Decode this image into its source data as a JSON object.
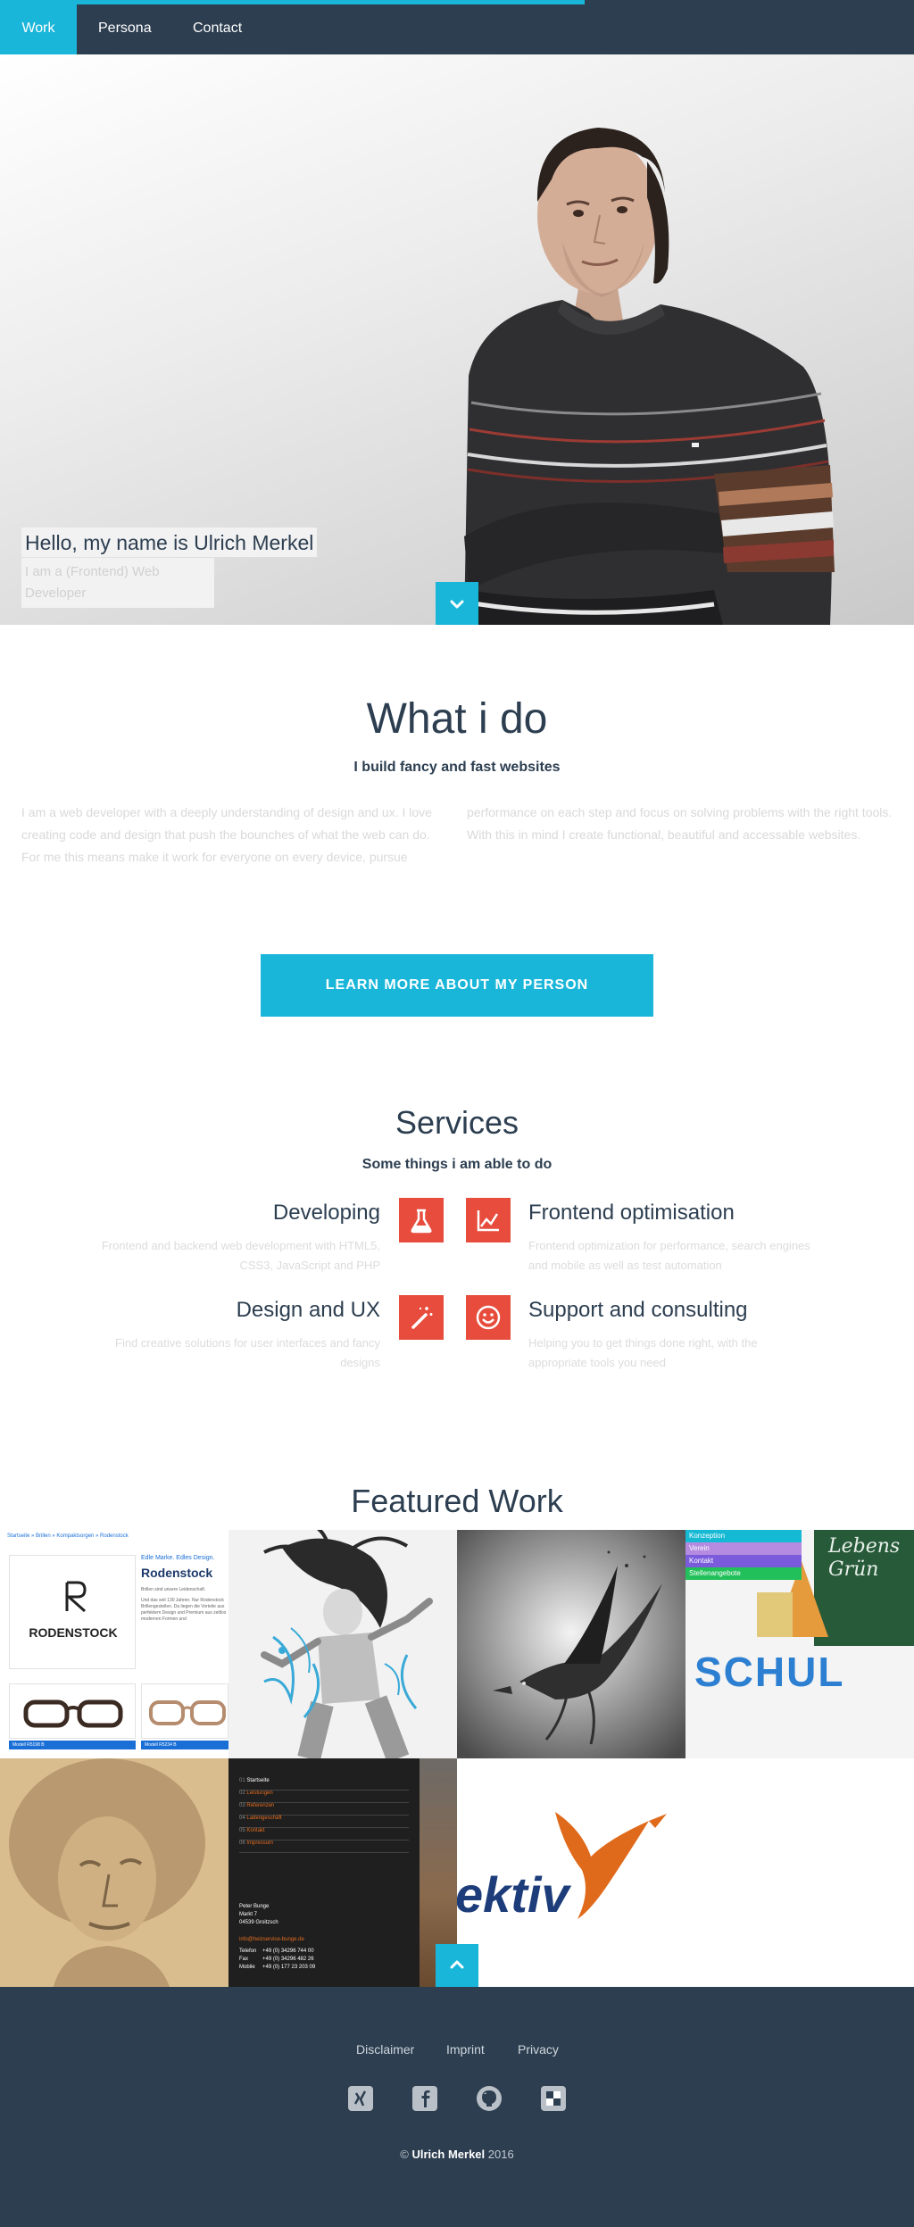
{
  "nav": {
    "items": [
      {
        "label": "Work",
        "active": true
      },
      {
        "label": "Persona",
        "active": false
      },
      {
        "label": "Contact",
        "active": false
      }
    ]
  },
  "hero": {
    "hello": "Hello, my name is Ulrich Merkel",
    "subtitle": "I am a (Frontend) Web Developer",
    "down_icon": "chevron-down-icon"
  },
  "whatido": {
    "title": "What i do",
    "subtitle": "I build fancy and fast websites",
    "para_left": "I am a web developer with a deeply understanding of design and ux. I love creating code and design that push the bounches of what the web can do. For me this means make it work for everyone on every device, pursue",
    "para_right": "performance on each step and focus on solving problems with the right tools. With this in mind I create functional, beautiful and accessable websites.",
    "cta": "LEARN MORE ABOUT MY PERSON"
  },
  "services": {
    "title": "Services",
    "subtitle": "Some things i am able to do",
    "items": [
      {
        "title": "Developing",
        "text": "Frontend and backend web development with HTML5, CSS3, JavaScript and PHP",
        "icon": "flask-icon"
      },
      {
        "title": "Frontend optimisation",
        "text": "Frontend optimization for performance, search engines and mobile as well as test automation",
        "icon": "chart-icon"
      },
      {
        "title": "Design and UX",
        "text": "Find creative solutions for user interfaces and fancy designs",
        "icon": "magic-wand-icon"
      },
      {
        "title": "Support and consulting",
        "text": "Helping you to get things done right, with the appropriate tools you need",
        "icon": "smiley-icon"
      }
    ]
  },
  "featured": {
    "title": "Featured Work",
    "rodenstock": {
      "breadcrumb": "Startseite » Brillen » Kompaktsorgen » Rodenstock",
      "tagline": "Edle Marke. Edles Design.",
      "brand": "Rodenstock",
      "logo_text": "RODENSTOCK",
      "text1": "Brillen sind unsere Leidenschaft.",
      "text2": "Und das seit 130 Jahren. Nur Rodenstock Brillengestellen. Da liegen die Vorteile aus perfektem Design und Premium aus zeitlos modernen Formen und",
      "btn1": "Modell R5198 B",
      "btn2": "Modell R5234 B"
    },
    "menu_tile": {
      "items": [
        "Konzeption",
        "Verein",
        "Kontakt",
        "Stellenangebote"
      ]
    },
    "school_tile": {
      "word": "SCHUL",
      "board": "Lebens Grün"
    },
    "bunge": {
      "items": [
        {
          "num": "01",
          "label": "Startseite"
        },
        {
          "num": "02",
          "label": "Leistungen"
        },
        {
          "num": "03",
          "label": "Referenzen"
        },
        {
          "num": "04",
          "label": "Ladengeschäft"
        },
        {
          "num": "05",
          "label": "Kontakt"
        },
        {
          "num": "06",
          "label": "Impressum"
        }
      ],
      "address": [
        "Peter Bunge",
        "Markt 7",
        "04539 Groitzsch"
      ],
      "email": "info@heizservice-bunge.de",
      "phones": [
        {
          "label": "Telefon",
          "value": "+49 (0) 34296 744 00"
        },
        {
          "label": "Fax",
          "value": "+49 (0) 34296 482 26"
        },
        {
          "label": "Mobile",
          "value": "+49 (0) 177 23 203 09"
        }
      ]
    },
    "ektiv": {
      "word": "ektiv"
    }
  },
  "footer": {
    "links": [
      "Disclaimer",
      "Imprint",
      "Privacy"
    ],
    "social": [
      "xing-icon",
      "facebook-icon",
      "github-icon",
      "delicious-icon"
    ],
    "copyright_prefix": "©",
    "copyright_name": "Ulrich Merkel",
    "copyright_year": "2016"
  },
  "colors": {
    "navy": "#2c3e50",
    "accent": "#1ab6d9",
    "service_red": "#e74c3c",
    "muted": "#d9d9d9"
  }
}
